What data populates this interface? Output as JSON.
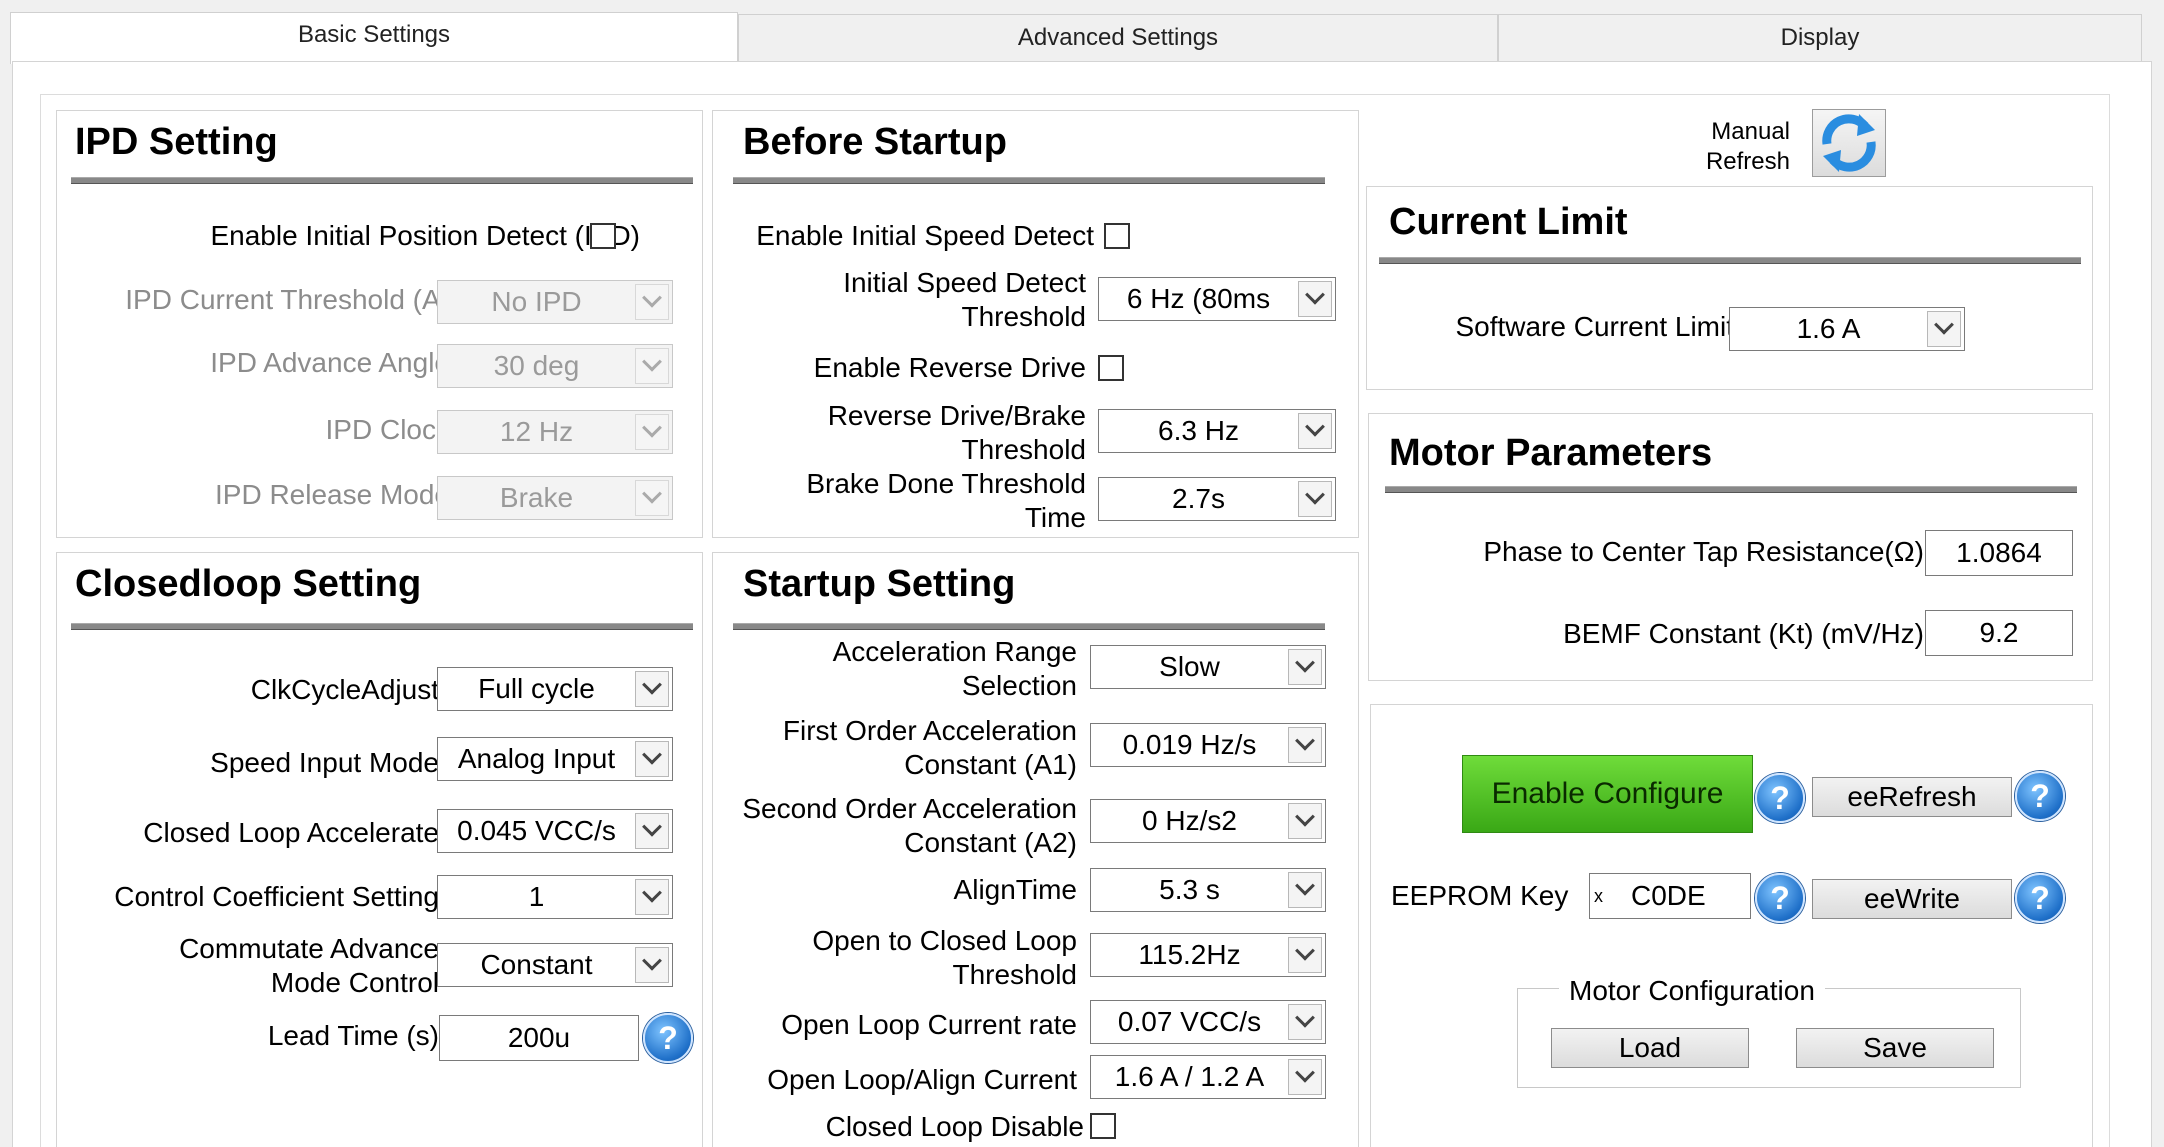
{
  "tabs": [
    "Basic Settings",
    "Advanced Settings",
    "Display"
  ],
  "ipd": {
    "title": "IPD Setting",
    "enable_label": "Enable Initial Position Detect (IPD)",
    "current_threshold_label": "IPD Current Threshold (A)",
    "current_threshold_value": "No IPD",
    "advance_angle_label": "IPD Advance Angle",
    "advance_angle_value": "30 deg",
    "clock_label": "IPD Clock",
    "clock_value": "12 Hz",
    "release_mode_label": "IPD Release Mode",
    "release_mode_value": "Brake"
  },
  "before_startup": {
    "title": "Before Startup",
    "initial_speed_detect_label": "Enable Initial Speed Detect",
    "initial_speed_threshold_label_1": "Initial Speed Detect",
    "initial_speed_threshold_label_2": "Threshold",
    "initial_speed_threshold_value": "6 Hz (80ms",
    "reverse_drive_label": "Enable Reverse Drive",
    "reverse_brake_label_1": "Reverse Drive/Brake",
    "reverse_brake_label_2": "Threshold",
    "reverse_brake_value": "6.3 Hz",
    "brake_done_label_1": "Brake Done Threshold",
    "brake_done_label_2": "Time",
    "brake_done_value": "2.7s"
  },
  "manual_refresh": {
    "label_1": "Manual",
    "label_2": "Refresh"
  },
  "current_limit": {
    "title": "Current Limit",
    "software_limit_label": "Software Current Limit",
    "software_limit_value": "1.6 A"
  },
  "motor_params": {
    "title": "Motor Parameters",
    "resistance_label": "Phase to Center Tap Resistance(Ω)",
    "resistance_value": "1.0864",
    "bemf_label": "BEMF Constant (Kt) (mV/Hz)",
    "bemf_value": "9.2"
  },
  "closedloop": {
    "title": "Closedloop Setting",
    "clk_cycle_label": "ClkCycleAdjust",
    "clk_cycle_value": "Full cycle",
    "speed_input_label": "Speed Input Mode",
    "speed_input_value": "Analog Input",
    "closed_accel_label": "Closed Loop Accelerate",
    "closed_accel_value": "0.045 VCC/s",
    "control_coeff_label": "Control Coefficient Setting",
    "control_coeff_value": "1",
    "commutate_label_1": "Commutate Advance",
    "commutate_label_2": "Mode Control",
    "commutate_value": "Constant",
    "lead_time_label": "Lead Time (s)",
    "lead_time_value": "200u"
  },
  "startup": {
    "title": "Startup Setting",
    "accel_range_label_1": "Acceleration Range",
    "accel_range_label_2": "Selection",
    "accel_range_value": "Slow",
    "first_order_label_1": "First Order Acceleration",
    "first_order_label_2": "Constant (A1)",
    "first_order_value": "0.019 Hz/s",
    "second_order_label_1": "Second Order Acceleration",
    "second_order_label_2": "Constant (A2)",
    "second_order_value": "0 Hz/s2",
    "align_time_label": "AlignTime",
    "align_time_value": "5.3 s",
    "open_closed_label_1": "Open to Closed Loop",
    "open_closed_label_2": "Threshold",
    "open_closed_value": "115.2Hz",
    "open_loop_rate_label": "Open Loop Current rate",
    "open_loop_rate_value": "0.07 VCC/s",
    "open_align_current_label": "Open Loop/Align Current",
    "open_align_current_value": "1.6 A / 1.2 A",
    "closed_loop_disable_label": "Closed Loop Disable"
  },
  "eeprom": {
    "enable_configure_label": "Enable Configure",
    "ee_refresh_label": "eeRefresh",
    "key_label": "EEPROM Key",
    "key_prefix": "x",
    "key_value": "C0DE",
    "ee_write_label": "eeWrite",
    "motor_config_label": "Motor Configuration",
    "load_label": "Load",
    "save_label": "Save"
  },
  "help_glyph": "?",
  "colors": {
    "accent_green": "#4cc222",
    "help_blue": "#1e6fc8",
    "rule_gray": "#888888"
  }
}
